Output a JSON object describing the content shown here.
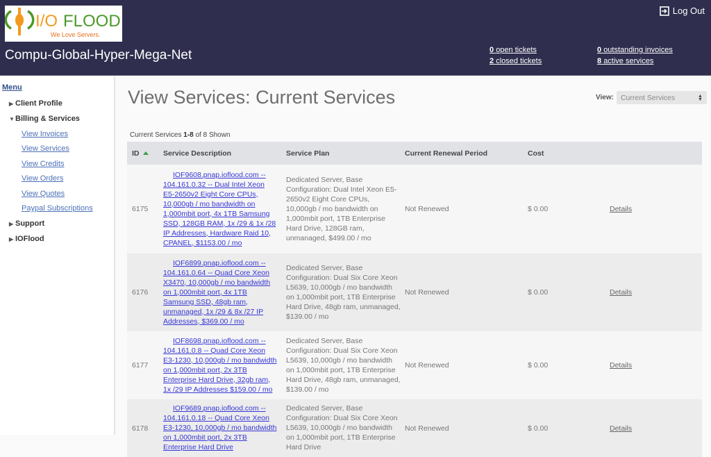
{
  "header": {
    "logo": {
      "brand": "I/O FLOOD",
      "tagline": "We Love Servers."
    },
    "company": "Compu-Global-Hyper-Mega-Net",
    "logout_label": "Log Out",
    "stats": {
      "open_tickets": {
        "count": "0",
        "label": "open tickets"
      },
      "closed_tickets": {
        "count": "2",
        "label": "closed tickets"
      },
      "outstanding_invoices": {
        "count": "0",
        "label": "outstanding invoices"
      },
      "active_services": {
        "count": "8",
        "label": "active services"
      }
    }
  },
  "sidebar": {
    "menu_label": "Menu",
    "items": [
      {
        "label": "Client Profile",
        "expanded": false
      },
      {
        "label": "Billing & Services",
        "expanded": true,
        "children": [
          "View Invoices",
          "View Services",
          "View Credits",
          "View Orders",
          "View Quotes",
          "Paypal Subscriptions"
        ]
      },
      {
        "label": "Support",
        "expanded": false
      },
      {
        "label": "IOFlood",
        "expanded": false
      }
    ]
  },
  "main": {
    "title": "View Services: Current Services",
    "view_label": "View:",
    "view_selected": "Current Services",
    "count": {
      "prefix": "Current Services",
      "range": "1-8",
      "suffix": "of 8 Shown"
    },
    "columns": [
      "ID",
      "Service Description",
      "Service Plan",
      "Current Renewal Period",
      "Cost",
      ""
    ],
    "rows": [
      {
        "id": "6175",
        "desc_host": "IOF9608.pnap.ioflood.com --",
        "desc_rest": "104.161.0.32 -- Dual Intel Xeon E5-2650v2 Eight Core CPUs, 10,000gb / mo bandwidth on 1,000mbit port, 4x 1TB Samsung SSD, 128GB RAM, 1x /29 & 1x /28 IP Addresses, Hardware Raid 10, CPANEL, $1153.00 / mo",
        "plan": "Dedicated Server, Base Configuration: Dual Intel Xeon E5-2650v2 Eight Core CPUs, 10,000gb / mo bandwidth on 1,000mbit port, 1TB Enterprise Hard Drive, 128GB ram, unmanaged, $499.00 / mo",
        "renewal": "Not Renewed",
        "cost": "$ 0.00",
        "action": "Details"
      },
      {
        "id": "6176",
        "desc_host": "IOF6899.pnap.ioflood.com --",
        "desc_rest": "104.161.0.64 -- Quad Core Xeon X3470, 10,000gb / mo bandwidth on 1,000mbit port, 4x 1TB Samsung SSD, 48gb ram, unmanaged, 1x /29 & 8x /27 IP Addresses, $369.00 / mo",
        "plan": "Dedicated Server, Base Configuration: Dual Six Core Xeon L5639, 10,000gb / mo bandwidth on 1,000mbit port, 1TB Enterprise Hard Drive, 48gb ram, unmanaged, $139.00 / mo",
        "renewal": "Not Renewed",
        "cost": "$ 0.00",
        "action": "Details"
      },
      {
        "id": "6177",
        "desc_host": "IOF8698.pnap.ioflood.com --",
        "desc_rest": "104.161.0.8 -- Quad Core Xeon E3-1230, 10,000gb / mo bandwidth on 1,000mbit port, 2x 3TB Enterprise Hard Drive, 32gb ram, 1x /29 IP Addresses $159.00 / mo",
        "plan": "Dedicated Server, Base Configuration: Dual Six Core Xeon L5639, 10,000gb / mo bandwidth on 1,000mbit port, 1TB Enterprise Hard Drive, 48gb ram, unmanaged, $139.00 / mo",
        "renewal": "Not Renewed",
        "cost": "$ 0.00",
        "action": "Details"
      },
      {
        "id": "6178",
        "desc_host": "IOF9689.pnap.ioflood.com --",
        "desc_rest": "104.161.0.18 -- Quad Core Xeon E3-1230, 10,000gb / mo bandwidth on 1,000mbit port, 2x 3TB Enterprise Hard Drive",
        "plan": "Dedicated Server, Base Configuration: Dual Six Core Xeon L5639, 10,000gb / mo bandwidth on 1,000mbit port, 1TB Enterprise Hard Drive",
        "renewal": "Not Renewed",
        "cost": "$ 0.00",
        "action": "Details"
      }
    ]
  }
}
